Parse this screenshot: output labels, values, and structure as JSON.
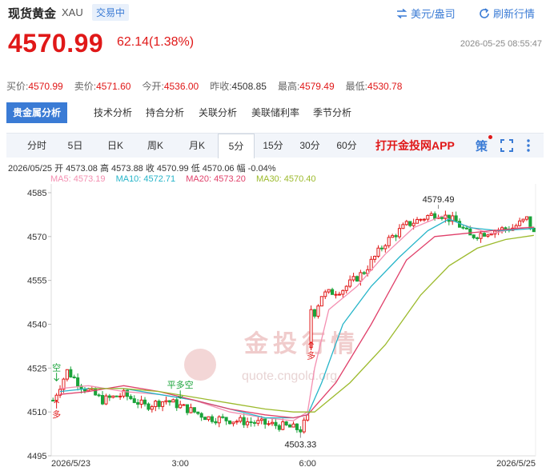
{
  "header": {
    "name": "现货黄金",
    "code": "XAU",
    "status": "交易中",
    "currency_link": "美元/盎司",
    "refresh_link": "刷新行情"
  },
  "price": {
    "last": "4570.99",
    "change": "62.14(1.38%)",
    "timestamp": "2026-05-25 08:55:47"
  },
  "quotes": [
    {
      "label": "买价:",
      "value": "4570.99",
      "color": "red"
    },
    {
      "label": "卖价:",
      "value": "4571.60",
      "color": "red"
    },
    {
      "label": "今开:",
      "value": "4536.00",
      "color": "red"
    },
    {
      "label": "昨收:",
      "value": "4508.85",
      "color": "black"
    },
    {
      "label": "最高:",
      "value": "4579.49",
      "color": "red"
    },
    {
      "label": "最低:",
      "value": "4530.78",
      "color": "red"
    }
  ],
  "analysis_tabs": [
    "贵金属分析",
    "技术分析",
    "持合分析",
    "关联分析",
    "美联储利率",
    "季节分析"
  ],
  "period_tabs": [
    "分时",
    "5日",
    "日K",
    "周K",
    "月K",
    "5分",
    "15分",
    "30分",
    "60分"
  ],
  "active_period": "5分",
  "app_link": "打开金投网APP",
  "toolbar": {
    "strategy_label": "策"
  },
  "bar_info": "2026/05/25  开 4573.08  高 4573.88  收 4570.99  低 4570.06  幅 -0.04%",
  "ma_legend": [
    {
      "label": "MA5: 4573.19",
      "color": "#f48fb1"
    },
    {
      "label": "MA10: 4572.71",
      "color": "#26b5c9"
    },
    {
      "label": "MA20: 4573.20",
      "color": "#e0406a"
    },
    {
      "label": "MA30: 4570.40",
      "color": "#9cba2c"
    }
  ],
  "watermark": {
    "text": "金投行情",
    "url": "quote.cngold.org"
  },
  "colors": {
    "up": "#e01818",
    "down": "#1aa33a",
    "accent": "#3a7bd5"
  },
  "chart_data": {
    "type": "candlestick",
    "y_ticks": [
      4585,
      4570,
      4555,
      4540,
      4525,
      4510,
      4495
    ],
    "ylim": [
      4495,
      4588
    ],
    "x_ticks": [
      {
        "label": "2026/5/23",
        "index": 0
      },
      {
        "label": "3:00",
        "index": 36
      },
      {
        "label": "6:00",
        "index": 72
      },
      {
        "label": "2026/5/25",
        "index": 134
      }
    ],
    "annotations": [
      {
        "text": "4579.49",
        "index": 109,
        "value": 4579.49,
        "kind": "high"
      },
      {
        "text": "4503.33",
        "index": 70,
        "value": 4503.33,
        "kind": "low"
      },
      {
        "text": "平多空",
        "index": 36,
        "value": 4516,
        "kind": "signal"
      },
      {
        "text": "空",
        "index": 1,
        "value": 4522,
        "kind": "signal"
      },
      {
        "text": "多",
        "index": 1,
        "value": 4512,
        "kind": "signal"
      },
      {
        "text": "多",
        "index": 73,
        "value": 4532,
        "kind": "signal"
      }
    ],
    "ma_series": [
      {
        "name": "MA5",
        "color": "#f48fb1",
        "points": [
          [
            2,
            4518
          ],
          [
            10,
            4519
          ],
          [
            20,
            4517
          ],
          [
            30,
            4516
          ],
          [
            40,
            4514
          ],
          [
            50,
            4510
          ],
          [
            60,
            4508
          ],
          [
            68,
            4507
          ],
          [
            72,
            4510
          ],
          [
            74,
            4525
          ],
          [
            78,
            4545
          ],
          [
            86,
            4553
          ],
          [
            94,
            4564
          ],
          [
            102,
            4573
          ],
          [
            110,
            4577
          ],
          [
            116,
            4574
          ],
          [
            124,
            4571
          ],
          [
            132,
            4573
          ],
          [
            136,
            4573.2
          ]
        ]
      },
      {
        "name": "MA10",
        "color": "#26b5c9",
        "points": [
          [
            2,
            4517
          ],
          [
            10,
            4518
          ],
          [
            20,
            4518
          ],
          [
            30,
            4516
          ],
          [
            40,
            4514
          ],
          [
            50,
            4511
          ],
          [
            60,
            4508
          ],
          [
            68,
            4508
          ],
          [
            72,
            4509
          ],
          [
            76,
            4520
          ],
          [
            82,
            4540
          ],
          [
            90,
            4553
          ],
          [
            98,
            4563
          ],
          [
            106,
            4572
          ],
          [
            112,
            4576
          ],
          [
            118,
            4573
          ],
          [
            126,
            4572
          ],
          [
            136,
            4572.7
          ]
        ]
      },
      {
        "name": "MA20",
        "color": "#e0406a",
        "points": [
          [
            2,
            4516
          ],
          [
            10,
            4517
          ],
          [
            20,
            4519
          ],
          [
            30,
            4517
          ],
          [
            40,
            4514
          ],
          [
            50,
            4511
          ],
          [
            60,
            4509
          ],
          [
            68,
            4508
          ],
          [
            72,
            4509
          ],
          [
            80,
            4520
          ],
          [
            90,
            4540
          ],
          [
            100,
            4562
          ],
          [
            108,
            4570
          ],
          [
            116,
            4571
          ],
          [
            124,
            4572
          ],
          [
            136,
            4573.2
          ]
        ]
      },
      {
        "name": "MA30",
        "color": "#9cba2c",
        "points": [
          [
            10,
            4518
          ],
          [
            20,
            4518
          ],
          [
            30,
            4517
          ],
          [
            40,
            4515
          ],
          [
            50,
            4513
          ],
          [
            60,
            4511
          ],
          [
            68,
            4510
          ],
          [
            74,
            4510
          ],
          [
            84,
            4520
          ],
          [
            94,
            4533
          ],
          [
            104,
            4550
          ],
          [
            112,
            4560
          ],
          [
            120,
            4566
          ],
          [
            128,
            4569
          ],
          [
            136,
            4570.4
          ]
        ]
      }
    ]
  }
}
